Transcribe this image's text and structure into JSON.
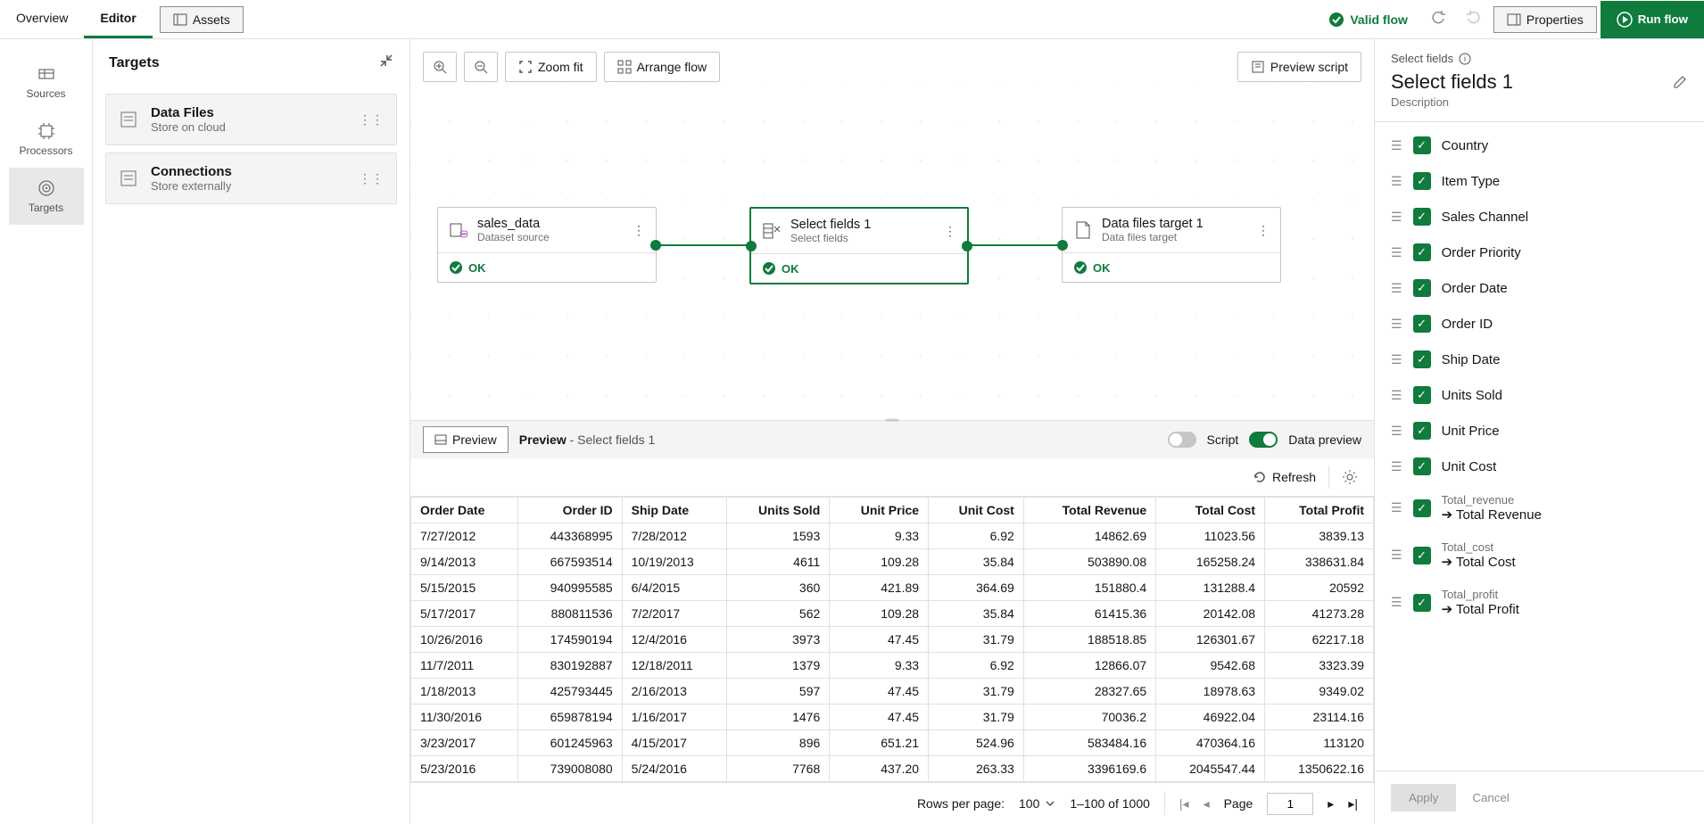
{
  "topbar": {
    "tab_overview": "Overview",
    "tab_editor": "Editor",
    "assets": "Assets",
    "valid": "Valid flow",
    "properties": "Properties",
    "run": "Run flow"
  },
  "rail": {
    "sources": "Sources",
    "processors": "Processors",
    "targets": "Targets"
  },
  "targets_panel": {
    "title": "Targets",
    "cards": [
      {
        "title": "Data Files",
        "sub": "Store on cloud"
      },
      {
        "title": "Connections",
        "sub": "Store externally"
      }
    ]
  },
  "canvas": {
    "zoom_fit": "Zoom fit",
    "arrange": "Arrange flow",
    "preview_script": "Preview script",
    "nodes": [
      {
        "title": "sales_data",
        "sub": "Dataset source",
        "status": "OK"
      },
      {
        "title": "Select fields 1",
        "sub": "Select fields",
        "status": "OK"
      },
      {
        "title": "Data files target 1",
        "sub": "Data files target",
        "status": "OK"
      }
    ]
  },
  "preview_bar": {
    "preview": "Preview",
    "title": "Preview",
    "sub": " - Select fields 1",
    "script": "Script",
    "data_preview": "Data preview",
    "refresh": "Refresh"
  },
  "table": {
    "headers": [
      "Order Date",
      "Order ID",
      "Ship Date",
      "Units Sold",
      "Unit Price",
      "Unit Cost",
      "Total Revenue",
      "Total Cost",
      "Total Profit"
    ],
    "align": [
      "L",
      "R",
      "L",
      "R",
      "R",
      "R",
      "R",
      "R",
      "R"
    ],
    "rows": [
      [
        "7/27/2012",
        "443368995",
        "7/28/2012",
        "1593",
        "9.33",
        "6.92",
        "14862.69",
        "11023.56",
        "3839.13"
      ],
      [
        "9/14/2013",
        "667593514",
        "10/19/2013",
        "4611",
        "109.28",
        "35.84",
        "503890.08",
        "165258.24",
        "338631.84"
      ],
      [
        "5/15/2015",
        "940995585",
        "6/4/2015",
        "360",
        "421.89",
        "364.69",
        "151880.4",
        "131288.4",
        "20592"
      ],
      [
        "5/17/2017",
        "880811536",
        "7/2/2017",
        "562",
        "109.28",
        "35.84",
        "61415.36",
        "20142.08",
        "41273.28"
      ],
      [
        "10/26/2016",
        "174590194",
        "12/4/2016",
        "3973",
        "47.45",
        "31.79",
        "188518.85",
        "126301.67",
        "62217.18"
      ],
      [
        "11/7/2011",
        "830192887",
        "12/18/2011",
        "1379",
        "9.33",
        "6.92",
        "12866.07",
        "9542.68",
        "3323.39"
      ],
      [
        "1/18/2013",
        "425793445",
        "2/16/2013",
        "597",
        "47.45",
        "31.79",
        "28327.65",
        "18978.63",
        "9349.02"
      ],
      [
        "11/30/2016",
        "659878194",
        "1/16/2017",
        "1476",
        "47.45",
        "31.79",
        "70036.2",
        "46922.04",
        "23114.16"
      ],
      [
        "3/23/2017",
        "601245963",
        "4/15/2017",
        "896",
        "651.21",
        "524.96",
        "583484.16",
        "470364.16",
        "113120"
      ],
      [
        "5/23/2016",
        "739008080",
        "5/24/2016",
        "7768",
        "437.20",
        "263.33",
        "3396169.6",
        "2045547.44",
        "1350622.16"
      ]
    ]
  },
  "pager": {
    "rows_per_page": "Rows per page:",
    "rpp_val": "100",
    "range": "1–100 of 1000",
    "page_label": "Page",
    "page_val": "1"
  },
  "rightpanel": {
    "crumb": "Select fields",
    "title": "Select fields 1",
    "desc": "Description",
    "fields": [
      {
        "label": "Country"
      },
      {
        "label": "Item Type"
      },
      {
        "label": "Sales Channel"
      },
      {
        "label": "Order Priority"
      },
      {
        "label": "Order Date"
      },
      {
        "label": "Order ID"
      },
      {
        "label": "Ship Date"
      },
      {
        "label": "Units Sold"
      },
      {
        "label": "Unit Price"
      },
      {
        "label": "Unit Cost"
      },
      {
        "label": "Total Revenue",
        "from": "Total_revenue"
      },
      {
        "label": "Total Cost",
        "from": "Total_cost"
      },
      {
        "label": "Total Profit",
        "from": "Total_profit"
      }
    ],
    "apply": "Apply",
    "cancel": "Cancel"
  }
}
